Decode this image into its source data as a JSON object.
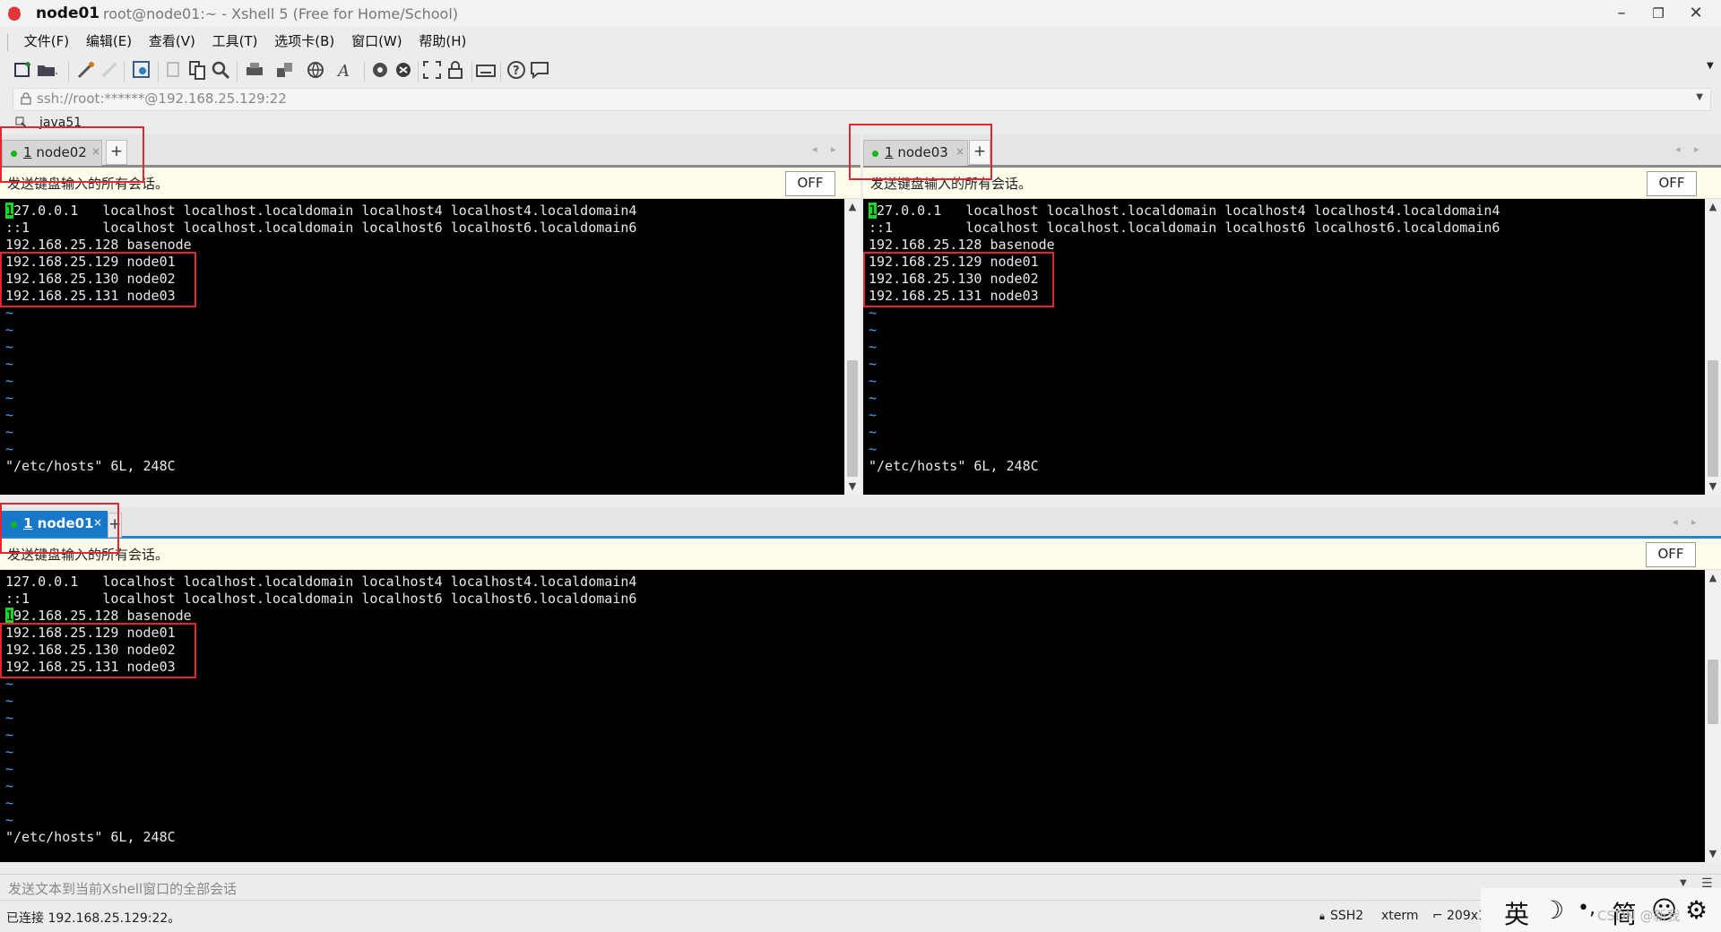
{
  "window": {
    "session_name": "node01",
    "title": "root@node01:~ - Xshell 5 (Free for Home/School)",
    "controls": {
      "minimize": "–",
      "maximize": "❐",
      "close": "✕"
    }
  },
  "menu": [
    "文件(F)",
    "编辑(E)",
    "查看(V)",
    "工具(T)",
    "选项卡(B)",
    "窗口(W)",
    "帮助(H)"
  ],
  "toolbar_icons": [
    "new-session-icon",
    "open-folder-icon",
    "connect-icon",
    "disconnect-icon",
    "properties-icon",
    "copy-icon",
    "paste-icon",
    "find-icon",
    "print-icon",
    "transfer-icon",
    "globe-icon",
    "font-icon",
    "xftp-icon",
    "xmanager-icon",
    "fullscreen-icon",
    "lock-icon",
    "keyboard-icon",
    "help-icon",
    "chat-icon"
  ],
  "address": {
    "text": "ssh://root:******@192.168.25.129:22"
  },
  "session_tree": {
    "label": "java51"
  },
  "panes": [
    {
      "tab": {
        "number": "1",
        "name": "node02",
        "close": "×",
        "active": false
      },
      "broadcast": {
        "text": "发送键盘输入的所有会话。",
        "toggle": "OFF"
      },
      "lines": [
        "127.0.0.1   localhost localhost.localdomain localhost4 localhost4.localdomain4",
        "::1         localhost localhost.localdomain localhost6 localhost6.localdomain6",
        "192.168.25.128 basenode",
        "192.168.25.129 node01",
        "192.168.25.130 node02",
        "192.168.25.131 node03"
      ],
      "cursor_line": 0,
      "tilde_count": 9,
      "status_line": "\"/etc/hosts\" 6L, 248C"
    },
    {
      "tab": {
        "number": "1",
        "name": "node03",
        "close": "×",
        "active": false
      },
      "broadcast": {
        "text": "发送键盘输入的所有会话。",
        "toggle": "OFF"
      },
      "lines": [
        "127.0.0.1   localhost localhost.localdomain localhost4 localhost4.localdomain4",
        "::1         localhost localhost.localdomain localhost6 localhost6.localdomain6",
        "192.168.25.128 basenode",
        "192.168.25.129 node01",
        "192.168.25.130 node02",
        "192.168.25.131 node03"
      ],
      "cursor_line": 0,
      "tilde_count": 9,
      "status_line": "\"/etc/hosts\" 6L, 248C"
    },
    {
      "tab": {
        "number": "1",
        "name": "node01",
        "close": "×",
        "active": true
      },
      "broadcast": {
        "text": "发送键盘输入的所有会话。",
        "toggle": "OFF"
      },
      "lines": [
        "127.0.0.1   localhost localhost.localdomain localhost4 localhost4.localdomain4",
        "::1         localhost localhost.localdomain localhost6 localhost6.localdomain6",
        "192.168.25.128 basenode",
        "192.168.25.129 node01",
        "192.168.25.130 node02",
        "192.168.25.131 node03"
      ],
      "cursor_line": 2,
      "tilde_count": 9,
      "status_line": "\"/etc/hosts\" 6L, 248C"
    }
  ],
  "compose_bar": {
    "text": "发送文本到当前Xshell窗口的全部会话"
  },
  "status": {
    "connection": "已连接 192.168.25.129:22。",
    "protocol": "SSH2",
    "terminal": "xterm",
    "size": "209x1"
  },
  "ime": [
    "英",
    "☽",
    "•,",
    "简",
    "☺",
    "⚙"
  ],
  "watermark": "CSDN @新我",
  "colors": {
    "accent": "#1777c8",
    "highlight_box": "#e3262f",
    "tilde": "#4aa3ff",
    "cursor": "#1bd62b"
  }
}
